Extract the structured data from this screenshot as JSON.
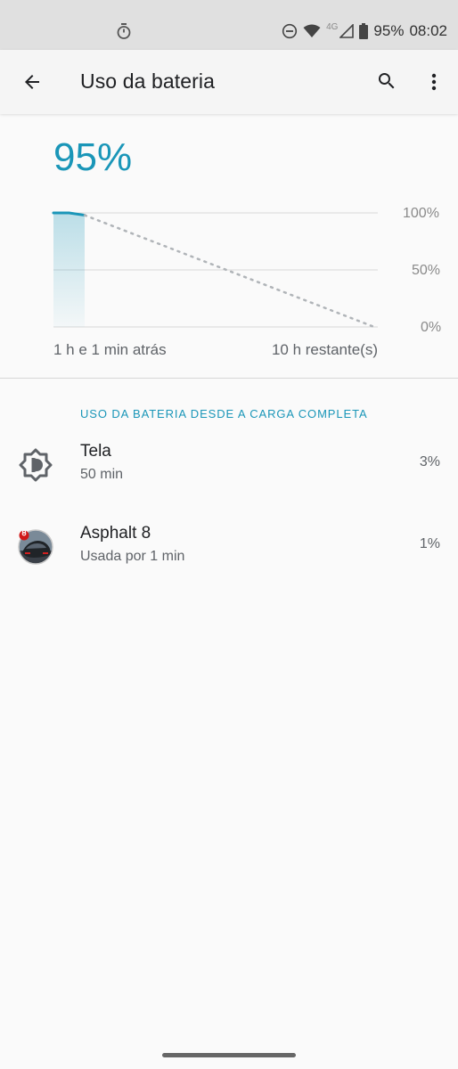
{
  "status_bar": {
    "network": "4G",
    "battery_percent": "95%",
    "time": "08:02",
    "icons": [
      "stopwatch-icon",
      "do-not-disturb-icon",
      "wifi-icon",
      "cell-signal-icon",
      "battery-icon"
    ]
  },
  "app_bar": {
    "title": "Uso da bateria",
    "icons": [
      "back-arrow-icon",
      "search-icon",
      "more-vert-icon"
    ]
  },
  "battery": {
    "percent": "95%",
    "accent_color": "#1a96b8"
  },
  "chart_data": {
    "type": "line",
    "y_ticks": [
      "100%",
      "50%",
      "0%"
    ],
    "x_labels": [
      "1 h e 1 min atrás",
      "10 h restante(s)"
    ],
    "ylim": [
      0,
      100
    ],
    "series": [
      {
        "values": [
          100,
          100,
          98
        ]
      },
      {
        "values": [
          98,
          0
        ]
      }
    ]
  },
  "section": {
    "title": "USO DA BATERIA DESDE A CARGA COMPLETA"
  },
  "items": [
    {
      "icon": "brightness-icon",
      "title": "Tela",
      "subtitle": "50 min",
      "percent": "3%"
    },
    {
      "icon": "asphalt-8-app-icon",
      "title": "Asphalt 8",
      "subtitle": "Usada por 1 min",
      "percent": "1%"
    }
  ]
}
